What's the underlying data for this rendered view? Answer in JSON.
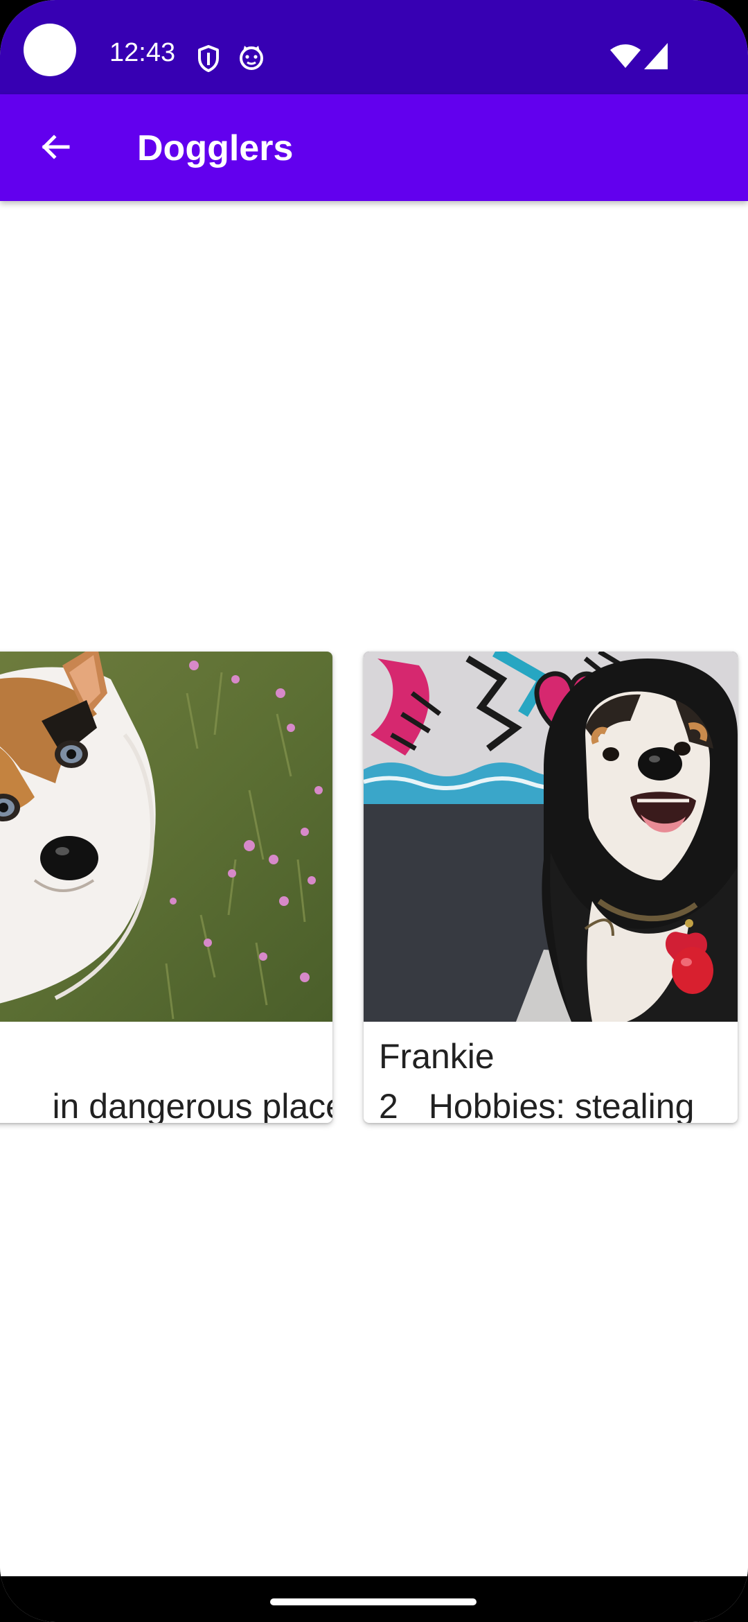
{
  "status_bar": {
    "time": "12:43",
    "background_color": "#3700B3",
    "icons": [
      "shield-icon",
      "cat-icon",
      "wifi-icon",
      "signal-icon"
    ]
  },
  "app_bar": {
    "title": "Dogglers",
    "background_color": "#6200EE",
    "back_icon": "arrow-left-icon"
  },
  "dogs": [
    {
      "name": "",
      "age": "",
      "hobbies": "in dangerous place",
      "photo": "corgi-photo"
    },
    {
      "name": "Frankie",
      "age": "2",
      "hobbies": "Hobbies: stealing",
      "photo": "bernedoodle-photo"
    }
  ]
}
